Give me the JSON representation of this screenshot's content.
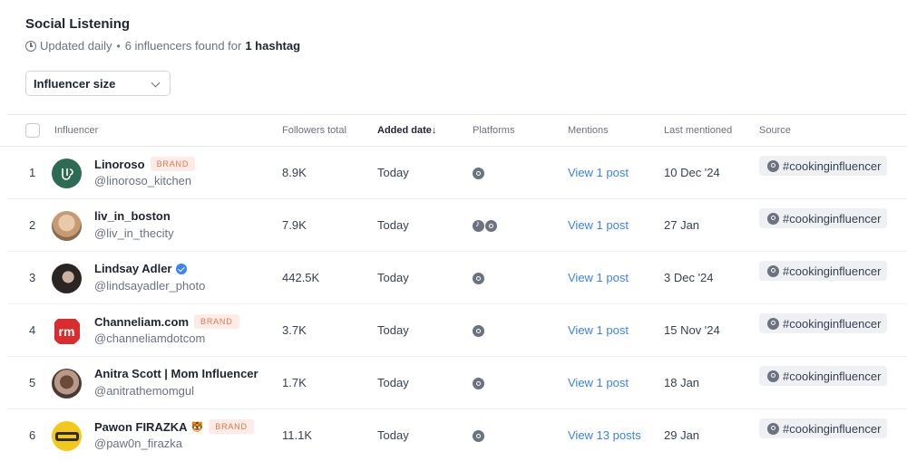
{
  "page": {
    "title": "Social Listening",
    "updated": "Updated daily",
    "found_text": "6 influencers found for",
    "found_bold": "1 hashtag"
  },
  "filter": {
    "label": "Influencer size"
  },
  "columns": {
    "influencer": "Influencer",
    "followers": "Followers total",
    "added": "Added date↓",
    "platforms": "Platforms",
    "mentions": "Mentions",
    "last": "Last mentioned",
    "source": "Source"
  },
  "rows": [
    {
      "idx": "1",
      "name": "Linoroso",
      "badge": "BRAND",
      "handle": "@linoroso_kitchen",
      "followers": "8.9K",
      "added": "Today",
      "platforms": [
        "instagram"
      ],
      "mentions": "View 1 post",
      "last": "10 Dec '24",
      "source": "#cookinginfluencer"
    },
    {
      "idx": "2",
      "name": "liv_in_boston",
      "handle": "@liv_in_thecity",
      "followers": "7.9K",
      "added": "Today",
      "platforms": [
        "tiktok",
        "instagram"
      ],
      "mentions": "View 1 post",
      "last": "27 Jan",
      "source": "#cookinginfluencer"
    },
    {
      "idx": "3",
      "name": "Lindsay Adler",
      "handle": "@lindsayadler_photo",
      "followers": "442.5K",
      "added": "Today",
      "platforms": [
        "instagram"
      ],
      "mentions": "View 1 post",
      "last": "3 Dec '24",
      "source": "#cookinginfluencer"
    },
    {
      "idx": "4",
      "name": "Channeliam.com",
      "badge": "BRAND",
      "handle": "@channeliamdotcom",
      "followers": "3.7K",
      "added": "Today",
      "platforms": [
        "instagram"
      ],
      "mentions": "View 1 post",
      "last": "15 Nov '24",
      "source": "#cookinginfluencer"
    },
    {
      "idx": "5",
      "name": "Anitra Scott | Mom Influencer",
      "handle": "@anitrathemomgul",
      "followers": "1.7K",
      "added": "Today",
      "platforms": [
        "instagram"
      ],
      "mentions": "View 1 post",
      "last": "18 Jan",
      "source": "#cookinginfluencer"
    },
    {
      "idx": "6",
      "name": "Pawon FIRAZKA",
      "emoji": "🐯",
      "badge": "BRAND",
      "handle": "@paw0n_firazka",
      "followers": "11.1K",
      "added": "Today",
      "platforms": [
        "instagram"
      ],
      "mentions": "View 13 posts",
      "last": "29 Jan",
      "source": "#cookinginfluencer"
    }
  ],
  "colors": {
    "link": "#3b82f6",
    "badge_text": "#e07656",
    "badge_bg": "#fdece6",
    "verified": "#3b82f6"
  }
}
